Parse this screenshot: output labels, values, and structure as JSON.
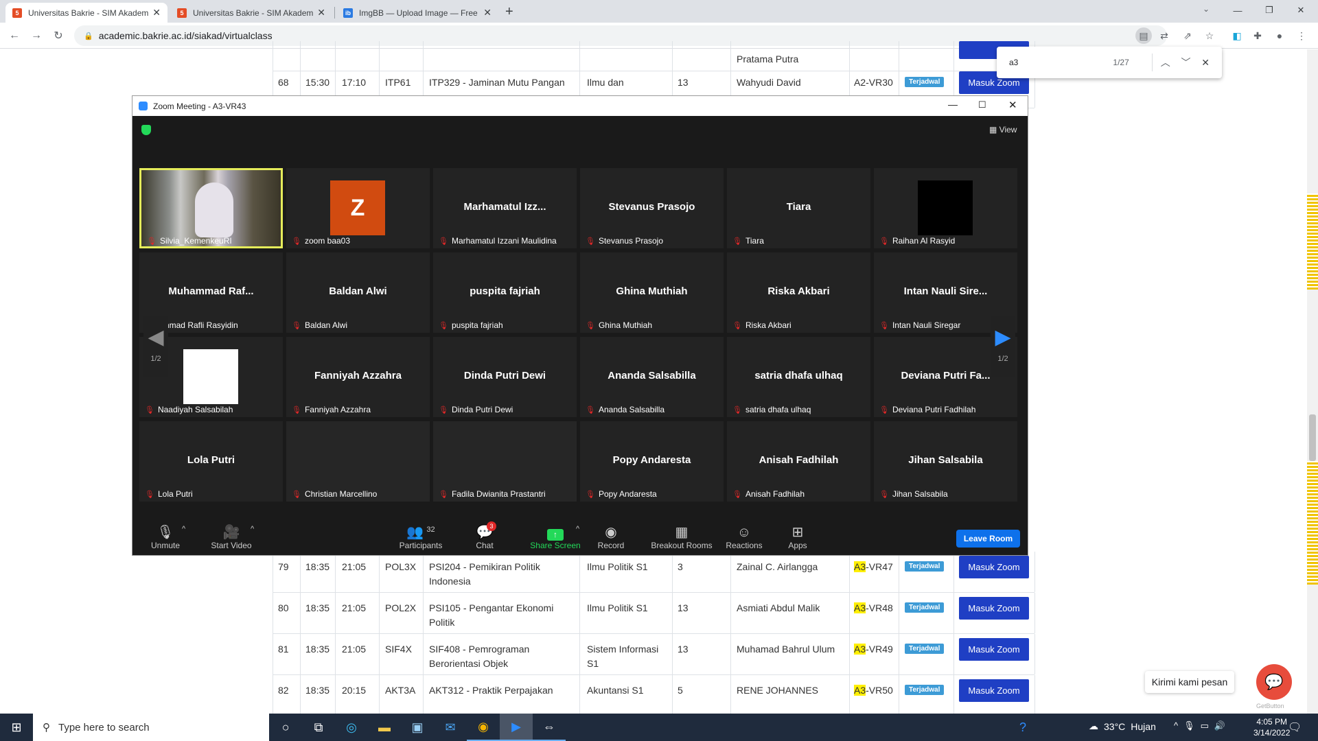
{
  "browser": {
    "tabs": [
      {
        "title": "Universitas Bakrie - SIM Akadem",
        "active": true
      },
      {
        "title": "Universitas Bakrie - SIM Akadem",
        "active": false
      },
      {
        "title": "ImgBB — Upload Image — Free",
        "active": false
      }
    ],
    "url": "academic.bakrie.ac.id/siakad/virtualclass",
    "new_tab": "+",
    "window_controls": [
      "—",
      "❐",
      "✕"
    ]
  },
  "find_bar": {
    "query": "a3",
    "count": "1/27"
  },
  "table": {
    "top_partial": {
      "lecturer": "Pratama Putra"
    },
    "rows": [
      {
        "no": "68",
        "start": "15:30",
        "end": "17:10",
        "class": "ITP61",
        "course": "ITP329 - Jaminan Mutu Pangan",
        "program": "Ilmu dan",
        "participants": "13",
        "lecturer": "Wahyudi David",
        "room_hl": "",
        "room": "A2-VR30",
        "status": "Terjadwal",
        "action": "Masuk Zoom"
      },
      {
        "no": "79",
        "start": "18:35",
        "end": "21:05",
        "class": "POL3X",
        "course": "PSI204 - Pemikiran Politik Indonesia",
        "program": "Ilmu Politik S1",
        "participants": "3",
        "lecturer": "Zainal C. Airlangga",
        "room_hl": "A3",
        "room": "-VR47",
        "status": "Terjadwal",
        "action": "Masuk Zoom"
      },
      {
        "no": "80",
        "start": "18:35",
        "end": "21:05",
        "class": "POL2X",
        "course": "PSI105 - Pengantar Ekonomi Politik",
        "program": "Ilmu Politik S1",
        "participants": "13",
        "lecturer": "Asmiati Abdul Malik",
        "room_hl": "A3",
        "room": "-VR48",
        "status": "Terjadwal",
        "action": "Masuk Zoom"
      },
      {
        "no": "81",
        "start": "18:35",
        "end": "21:05",
        "class": "SIF4X",
        "course": "SIF408 - Pemrograman Berorientasi Objek",
        "program": "Sistem Informasi S1",
        "participants": "13",
        "lecturer": "Muhamad Bahrul Ulum",
        "room_hl": "A3",
        "room": "-VR49",
        "status": "Terjadwal",
        "action": "Masuk Zoom"
      },
      {
        "no": "82",
        "start": "18:35",
        "end": "20:15",
        "class": "AKT3A",
        "course": "AKT312 - Praktik Perpajakan",
        "program": "Akuntansi S1",
        "participants": "5",
        "lecturer": "RENE JOHANNES",
        "room_hl": "A3",
        "room": "-VR50",
        "status": "Terjadwal",
        "action": "Masuk Zoom"
      }
    ]
  },
  "zoom": {
    "window_title": "Zoom Meeting - A3-VR43",
    "view_label": "View",
    "page_left": "1/2",
    "page_right": "1/2",
    "tiles": [
      {
        "center": "",
        "label": "Silvia_KemenkeuRI",
        "kind": "video"
      },
      {
        "center": "Z",
        "label": "zoom baa03",
        "kind": "avatar"
      },
      {
        "center": "Marhamatul  Izz...",
        "label": "Marhamatul Izzani Maulidina",
        "kind": "name"
      },
      {
        "center": "Stevanus Prasojo",
        "label": "Stevanus Prasojo",
        "kind": "name"
      },
      {
        "center": "Tiara",
        "label": "Tiara",
        "kind": "name"
      },
      {
        "center": "",
        "label": "Raihan Al Rasyid",
        "kind": "black"
      },
      {
        "center": "Muhammad  Raf...",
        "label": "ammad Rafli Rasyidin",
        "kind": "name"
      },
      {
        "center": "Baldan Alwi",
        "label": "Baldan Alwi",
        "kind": "name"
      },
      {
        "center": "puspita fajriah",
        "label": "puspita fajriah",
        "kind": "name"
      },
      {
        "center": "Ghina Muthiah",
        "label": "Ghina Muthiah",
        "kind": "name"
      },
      {
        "center": "Riska Akbari",
        "label": "Riska Akbari",
        "kind": "name"
      },
      {
        "center": "Intan  Nauli  Sire...",
        "label": "Intan Nauli Siregar",
        "kind": "name"
      },
      {
        "center": "",
        "label": "Naadiyah Salsabilah",
        "kind": "white"
      },
      {
        "center": "Fanniyah Azzahra",
        "label": "Fanniyah Azzahra",
        "kind": "name"
      },
      {
        "center": "Dinda Putri Dewi",
        "label": "Dinda Putri Dewi",
        "kind": "name"
      },
      {
        "center": "Ananda Salsabilla",
        "label": "Ananda Salsabilla",
        "kind": "name"
      },
      {
        "center": "satria dhafa ulhaq",
        "label": "satria dhafa ulhaq",
        "kind": "name"
      },
      {
        "center": "Deviana  Putri  Fa...",
        "label": "Deviana Putri Fadhilah",
        "kind": "name"
      },
      {
        "center": "Lola Putri",
        "label": "Lola Putri",
        "kind": "name"
      },
      {
        "center": "",
        "label": "Christian Marcellino",
        "kind": "video-dark"
      },
      {
        "center": "",
        "label": "Fadila Dwianita Prastantri",
        "kind": "video-dark"
      },
      {
        "center": "Popy Andaresta",
        "label": "Popy Andaresta",
        "kind": "name"
      },
      {
        "center": "Anisah Fadhilah",
        "label": "Anisah Fadhilah",
        "kind": "name"
      },
      {
        "center": "Jihan Salsabila",
        "label": "Jihan Salsabila",
        "kind": "name"
      }
    ],
    "controls": {
      "unmute": "Unmute",
      "start_video": "Start Video",
      "participants": "Participants",
      "participants_count": "32",
      "chat": "Chat",
      "chat_badge": "3",
      "share": "Share Screen",
      "record": "Record",
      "breakout": "Breakout Rooms",
      "reactions": "Reactions",
      "apps": "Apps",
      "leave": "Leave Room"
    }
  },
  "chat_widget": {
    "message": "Kirimi kami pesan",
    "brand": "GetButton"
  },
  "taskbar": {
    "search_placeholder": "Type here to search",
    "weather_temp": "33°C",
    "weather_desc": "Hujan",
    "time": "4:05 PM",
    "date": "3/14/2022"
  },
  "colors": {
    "zoom_bg": "#1a1a1a",
    "masuk_zoom": "#1f3fc4",
    "badge": "#3d9bd6",
    "leave": "#0e71eb",
    "highlight": "#ffef00"
  }
}
